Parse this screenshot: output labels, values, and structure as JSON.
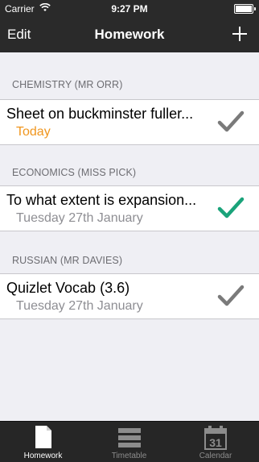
{
  "status_bar": {
    "carrier": "Carrier",
    "time": "9:27 PM"
  },
  "nav": {
    "edit_label": "Edit",
    "title": "Homework"
  },
  "sections": [
    {
      "header": "CHEMISTRY (MR ORR)",
      "item": {
        "title": "Sheet on buckminster fuller...",
        "due": "Today",
        "completed": false
      }
    },
    {
      "header": "ECONOMICS (MISS PICK)",
      "item": {
        "title": "To what extent is expansion...",
        "due": "Tuesday 27th January",
        "completed": true
      }
    },
    {
      "header": "RUSSIAN (MR DAVIES)",
      "item": {
        "title": "Quizlet Vocab (3.6)",
        "due": "Tuesday 27th January",
        "completed": false
      }
    }
  ],
  "tabs": [
    {
      "label": "Homework",
      "icon": "document-icon",
      "active": true
    },
    {
      "label": "Timetable",
      "icon": "list-icon",
      "active": false
    },
    {
      "label": "Calendar",
      "icon": "calendar-icon",
      "active": false,
      "badge": "31"
    }
  ],
  "colors": {
    "bar_bg": "#2a2a2a",
    "today": "#f0961e",
    "check_done": "#1aa37a",
    "check_pending": "#7a7a7a"
  }
}
